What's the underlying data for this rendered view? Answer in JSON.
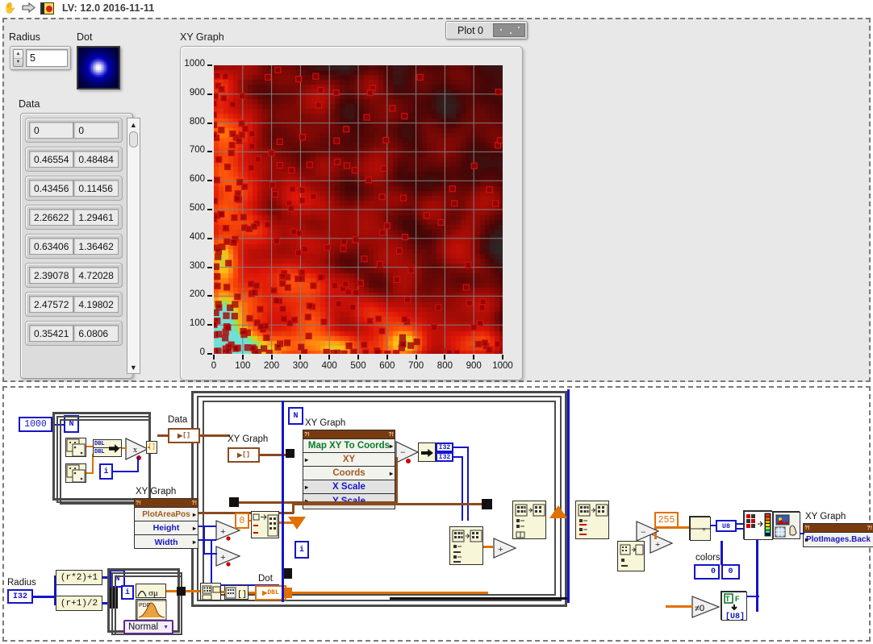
{
  "window": {
    "title": "LV: 12.0 2016-11-11",
    "icons": [
      "hand-cursor-icon",
      "run-arrow-icon",
      "labview-vi-icon"
    ]
  },
  "front_panel": {
    "radius": {
      "label": "Radius",
      "value": "5"
    },
    "dot": {
      "label": "Dot"
    },
    "data": {
      "label": "Data",
      "rows": [
        [
          "0",
          "0"
        ],
        [
          "0.46554",
          "0.48484"
        ],
        [
          "0.43456",
          "0.11456"
        ],
        [
          "2.26622",
          "1.29461"
        ],
        [
          "0.63406",
          "1.36462"
        ],
        [
          "2.39078",
          "4.72028"
        ],
        [
          "2.47572",
          "4.19802"
        ],
        [
          "0.35421",
          "6.0806"
        ]
      ]
    },
    "graph": {
      "label": "XY Graph",
      "legend": {
        "plot_name": "Plot 0"
      }
    }
  },
  "chart_data": {
    "type": "scatter",
    "title": "XY Graph",
    "xlabel": "",
    "ylabel": "",
    "xlim": [
      0,
      1000
    ],
    "ylim": [
      0,
      1000
    ],
    "xticks": [
      0,
      100,
      200,
      300,
      400,
      500,
      600,
      700,
      800,
      900,
      1000
    ],
    "yticks": [
      0,
      100,
      200,
      300,
      400,
      500,
      600,
      700,
      800,
      900,
      1000
    ],
    "grid": true,
    "background": "#2a2a2a",
    "gridcolor": "#808080",
    "legend_position": "top-right",
    "series": [
      {
        "name": "Plot 0",
        "marker": "square",
        "marker_color": "#8e0000",
        "marker_edge": "#cc1111",
        "description": "1000 random points, density-weighted exponential toward origin; rendered as a red heat-map background image with square plot markers overlaid",
        "density_peak": {
          "x": 30,
          "y": 25,
          "color": "#7fe5d8"
        }
      }
    ]
  },
  "block_diagram": {
    "constants": {
      "n_points": "1000",
      "zero": "0",
      "max_byte": "255",
      "colors_index": "0",
      "colors_value": "0"
    },
    "labels": {
      "data": "Data",
      "xy_graph_1": "XY Graph",
      "xy_graph_2": "XY Graph",
      "xy_graph_3": "XY Graph",
      "xy_graph_4": "XY Graph",
      "dot": "Dot",
      "radius": "Radius",
      "colors": "colors"
    },
    "terminals": {
      "loop_count_n": "N",
      "iterator_i": "i",
      "radius_type": "I32",
      "data_type": "DBL",
      "dot_type": "DBL",
      "u8_cast": "U8",
      "bool_u8": "[U8]",
      "tf": "T F"
    },
    "property_node_map_xy": {
      "title": "XY Graph",
      "rows": [
        {
          "text": "Map XY To Coords",
          "kind": "method"
        },
        {
          "text": "XY",
          "kind": "input"
        },
        {
          "text": "Coords",
          "kind": "output"
        },
        {
          "text": "X Scale",
          "kind": "disabled"
        },
        {
          "text": "Y Scale",
          "kind": "disabled"
        }
      ]
    },
    "property_node_plotarea": {
      "title": "XY Graph",
      "rows": [
        {
          "text": "PlotAreaPos",
          "kind": "property"
        },
        {
          "text": "Height",
          "kind": "property"
        },
        {
          "text": "Width",
          "kind": "property"
        }
      ]
    },
    "property_node_plotimages": {
      "title": "XY Graph",
      "rows": [
        {
          "text": "PlotImages.Back",
          "kind": "property"
        }
      ]
    },
    "formulas": {
      "f1": "(r*2)+1",
      "f2": "(r+1)/2"
    },
    "distribution_ring": {
      "value": "Normal"
    },
    "not_equal_zero": "≠0"
  },
  "colors": {
    "panel_bg": "#e8e8e8",
    "diagram_bg": "#ffffff",
    "plot_bg": "#2a2a2a",
    "wire_blue": "#1515c8",
    "wire_orange": "#e07000",
    "wire_brown": "#8a4b1e",
    "propnode_header": "#7a3a10",
    "struct_border": "#4a4a4a",
    "dot_blue": "#1a1acc"
  }
}
